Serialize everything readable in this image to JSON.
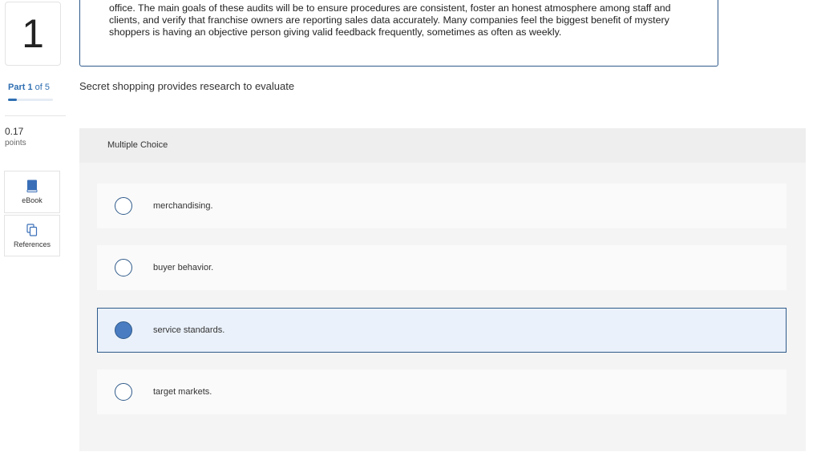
{
  "sidebar": {
    "question_number": "1",
    "part": {
      "prefix": "Part",
      "current": "1",
      "suffix": "of 5",
      "progress_fraction": 0.2
    },
    "points": {
      "value": "0.17",
      "label": "points"
    },
    "tools": [
      {
        "label": "eBook",
        "icon": "book-icon"
      },
      {
        "label": "References",
        "icon": "copy-pages-icon"
      }
    ]
  },
  "passage": {
    "text": "office. The main goals of these audits will be to ensure procedures are consistent, foster an honest atmosphere among staff and clients, and verify that franchise owners are reporting sales data accurately. Many companies feel the biggest benefit of mystery shoppers is having an objective person giving valid feedback frequently, sometimes as often as weekly."
  },
  "question": {
    "text": "Secret shopping provides research to evaluate"
  },
  "multiple_choice": {
    "header": "Multiple Choice",
    "options": [
      {
        "label": "merchandising.",
        "selected": false
      },
      {
        "label": "buyer behavior.",
        "selected": false
      },
      {
        "label": "service standards.",
        "selected": true
      },
      {
        "label": "target markets.",
        "selected": false
      }
    ]
  },
  "colors": {
    "accent": "#2f6fb2",
    "border_blue": "#2f5a8a",
    "radio_fill": "#4a7cc2",
    "selected_bg": "#eaf1fa"
  }
}
